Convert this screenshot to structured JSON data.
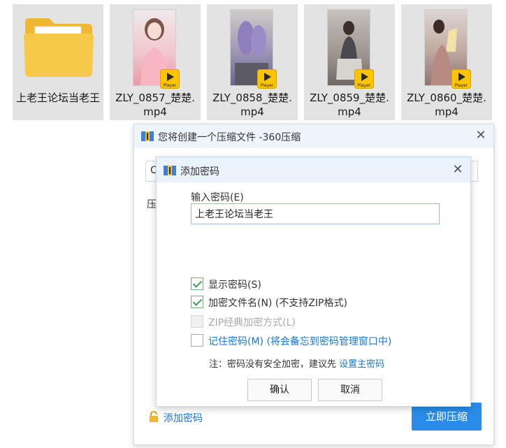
{
  "files": [
    {
      "name": "上老王论坛当老王",
      "type": "folder"
    },
    {
      "name": "ZLY_0857_楚楚.mp4",
      "type": "video",
      "thumb_color": "#f4cfd3"
    },
    {
      "name": "ZLY_0858_楚楚.mp4",
      "type": "video",
      "thumb_color": "#8b7fb1"
    },
    {
      "name": "ZLY_0859_楚楚.mp4",
      "type": "video",
      "thumb_color": "#9a8d86"
    },
    {
      "name": "ZLY_0860_楚楚.mp4",
      "type": "video",
      "thumb_color": "#b59a92"
    }
  ],
  "badge_text": "Player",
  "main_dialog": {
    "title": "您将创建一个压缩文件 -360压缩",
    "path_value": "C",
    "compress_label": "压",
    "add_password_link": "添加密码",
    "start_button": "立即压缩",
    "close_symbol": "✕"
  },
  "password_dialog": {
    "title": "添加密码",
    "close_symbol": "✕",
    "input_label": "输入密码(E)",
    "password_value": "上老王论坛当老王",
    "options": [
      {
        "label": "显示密码(S)",
        "checked": true,
        "enabled": true
      },
      {
        "label": "加密文件名(N) (不支持ZIP格式)",
        "checked": true,
        "enabled": true
      },
      {
        "label": "ZIP经典加密方式(L)",
        "checked": false,
        "enabled": false
      },
      {
        "label": "记住密码(M) (将会备忘到密码管理窗口中)",
        "checked": false,
        "enabled": true
      }
    ],
    "note_prefix": "注：密码没有安全加密，建议先",
    "note_link": "设置主密码",
    "confirm_button": "确认",
    "cancel_button": "取消"
  },
  "colors": {
    "accent": "#2a8be8",
    "link": "#1b75d0",
    "check": "#3c9e55",
    "tile_bg": "#e3e3e3"
  }
}
